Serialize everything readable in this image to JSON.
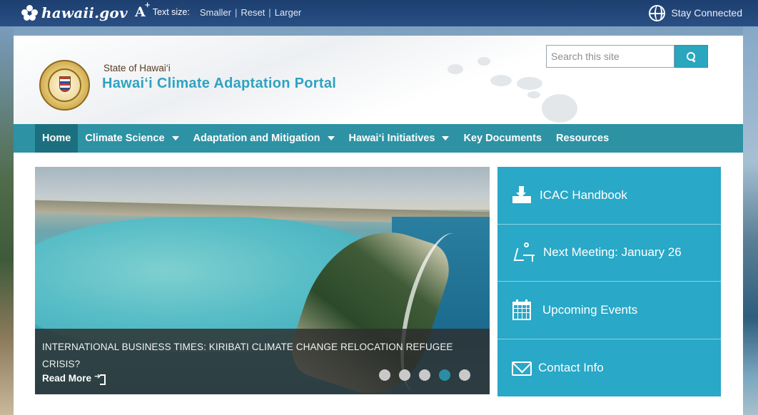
{
  "topbar": {
    "logo_text": "hawaii.gov",
    "text_size": {
      "icon_letter": "A",
      "icon_plus": "+",
      "label": "Text size:",
      "smaller": "Smaller",
      "reset": "Reset",
      "larger": "Larger",
      "separator": "|"
    },
    "stay_connected": "Stay Connected"
  },
  "header": {
    "state_label": "State of Hawai‘i",
    "site_title": "Hawai‘i Climate Adaptation Portal",
    "search_placeholder": "Search this site"
  },
  "nav": {
    "items": [
      {
        "label": "Home",
        "active": true,
        "dropdown": false
      },
      {
        "label": "Climate Science",
        "active": false,
        "dropdown": true
      },
      {
        "label": "Adaptation and Mitigation",
        "active": false,
        "dropdown": true
      },
      {
        "label": "Hawai‘i Initiatives",
        "active": false,
        "dropdown": true
      },
      {
        "label": "Key Documents",
        "active": false,
        "dropdown": false
      },
      {
        "label": "Resources",
        "active": false,
        "dropdown": false
      }
    ]
  },
  "carousel": {
    "headline": "INTERNATIONAL BUSINESS TIMES: KIRIBATI CLIMATE CHANGE RELOCATION REFUGEE CRISIS?",
    "read_more": "Read More",
    "slide_count": 5,
    "active_slide": 4
  },
  "quick_links": [
    {
      "label": "ICAC Handbook",
      "icon": "download-icon"
    },
    {
      "label": "Next Meeting: January 26",
      "icon": "meeting-icon"
    },
    {
      "label": "Upcoming Events",
      "icon": "calendar-icon"
    },
    {
      "label": "Contact Info",
      "icon": "envelope-icon"
    }
  ],
  "colors": {
    "topbar": "#1d3f70",
    "nav": "#2d92a4",
    "nav_active": "#1c6f7e",
    "title": "#2ea3c2",
    "quick_links": "#29a8c7",
    "search_button": "#2aa6be"
  }
}
